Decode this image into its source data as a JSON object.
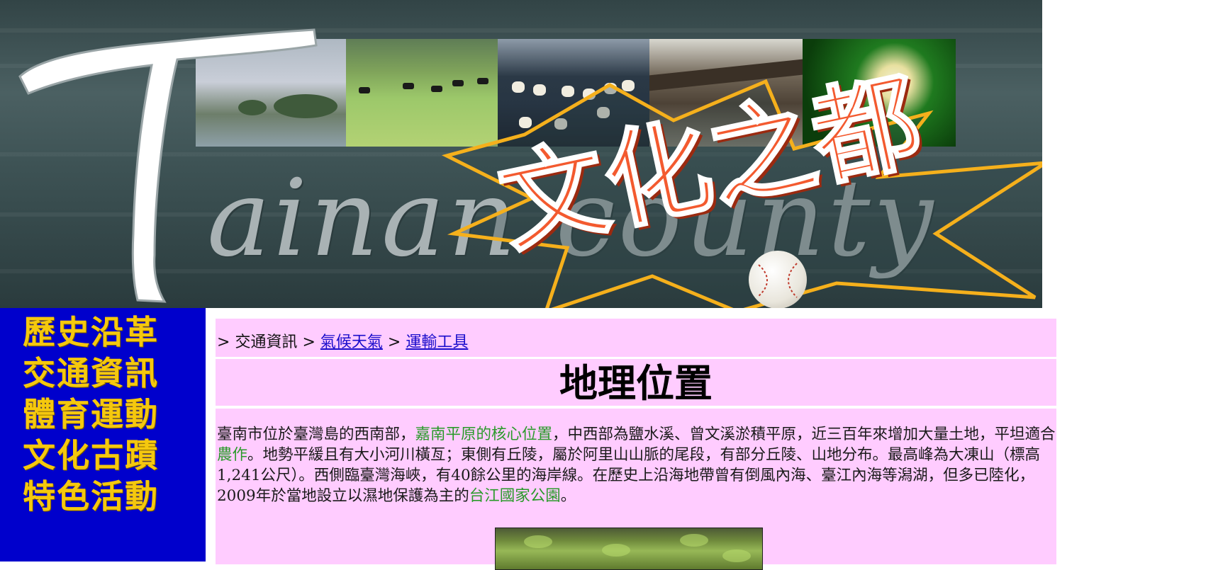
{
  "banner": {
    "tainan_text": "ainan county",
    "slogan": "文化之都"
  },
  "sidebar": {
    "items": [
      {
        "label": "歷史沿革"
      },
      {
        "label": "交通資訊"
      },
      {
        "label": "體育運動"
      },
      {
        "label": "文化古蹟"
      },
      {
        "label": "特色活動"
      }
    ]
  },
  "breadcrumb": {
    "prefix": ">",
    "current": "交通資訊",
    "separator": ">",
    "links": [
      {
        "label": "氣候天氣"
      },
      {
        "label": "運輸工具"
      }
    ]
  },
  "page": {
    "title": "地理位置",
    "body": [
      {
        "text": "臺南市位於臺灣島的西南部，",
        "highlight": false
      },
      {
        "text": "嘉南平原的核心位置",
        "highlight": true
      },
      {
        "text": "，中西部為鹽水溪、曾文溪淤積平原，近三百年來增加大量土地，平坦適合",
        "highlight": false
      },
      {
        "text": "農作",
        "highlight": true
      },
      {
        "text": "。地勢平緩且有大小河川橫亙；東側有丘陵，屬於阿里山山脈的尾段，有部分丘陵、山地分布。最高峰為大凍山（標高1,241公尺）。西側臨臺灣海峽，有40餘公里的海岸線。在歷史上沿海地帶曾有倒風內海、臺江內海等潟湖，但多已陸化，2009年於當地設立以濕地保護為主的",
        "highlight": false
      },
      {
        "text": "台江國家公園",
        "highlight": true
      },
      {
        "text": "。",
        "highlight": false
      }
    ]
  },
  "colors": {
    "sidebar_bg": "#0000cc",
    "nav_text": "#f5c80e",
    "content_bg": "#ffccff",
    "link": "#1a0dcc",
    "highlight": "#2a9a2a"
  }
}
